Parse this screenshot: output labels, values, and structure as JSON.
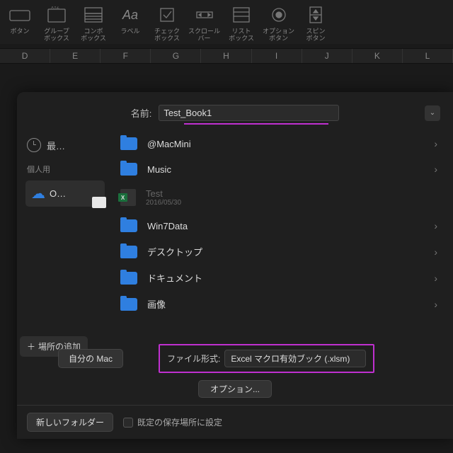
{
  "ribbon": {
    "items": [
      {
        "label": "ボタン"
      },
      {
        "label": "グループ\nボックス"
      },
      {
        "label": "コンボ\nボックス"
      },
      {
        "label": "ラベル"
      },
      {
        "label": "チェック\nボックス"
      },
      {
        "label": "スクロール\nバー"
      },
      {
        "label": "リスト\nボックス"
      },
      {
        "label": "オプション\nボタン"
      },
      {
        "label": "スピン\nボタン"
      }
    ]
  },
  "columns": [
    "D",
    "E",
    "F",
    "G",
    "H",
    "I",
    "J",
    "K",
    "L"
  ],
  "dialog": {
    "name_label": "名前:",
    "name_value": "Test_Book1",
    "sidebar": {
      "recent_label": "最…",
      "personal_label": "個人用",
      "onedrive_label": "O…",
      "add_place": "場所の追加"
    },
    "files": [
      {
        "type": "folder",
        "name": "@MacMini"
      },
      {
        "type": "folder",
        "name": "Music"
      },
      {
        "type": "excel",
        "name": "Test",
        "date": "2016/05/30"
      },
      {
        "type": "folder",
        "name": "Win7Data"
      },
      {
        "type": "folder",
        "name": "デスクトップ"
      },
      {
        "type": "folder",
        "name": "ドキュメント"
      },
      {
        "type": "folder",
        "name": "画像"
      }
    ],
    "footer": {
      "my_mac": "自分の Mac",
      "format_label": "ファイル形式:",
      "format_value": "Excel マクロ有効ブック (.xlsm)",
      "options": "オプション...",
      "new_folder": "新しいフォルダー",
      "default_location": "既定の保存場所に設定"
    }
  }
}
